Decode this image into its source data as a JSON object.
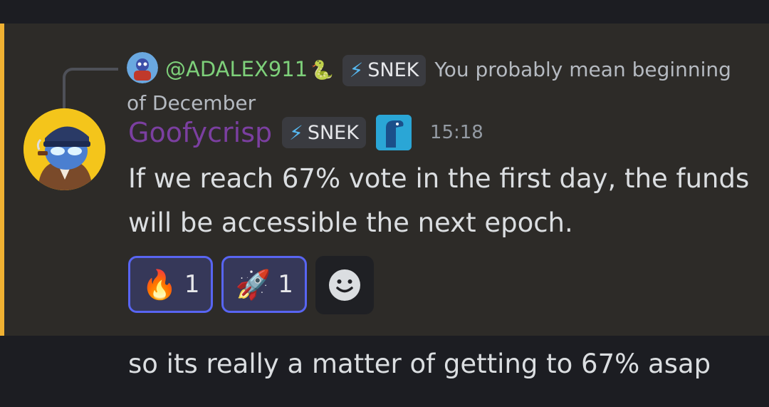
{
  "reply": {
    "username": "@ADALEX911",
    "username_emoji": "🐍",
    "tag_icon": "⚡",
    "tag_label": "SNEK",
    "text": "You probably mean beginning of December"
  },
  "message": {
    "username": "Goofycrisp",
    "tag_icon": "⚡",
    "tag_label": "SNEK",
    "timestamp": "15:18",
    "text": "If we reach 67% vote in the first day, the funds will be accessible the next epoch."
  },
  "reactions": [
    {
      "emoji": "🔥",
      "count": "1"
    },
    {
      "emoji": "🚀",
      "count": "1"
    }
  ],
  "next_message": {
    "text": "so its really a matter of getting to 67% asap"
  },
  "colors": {
    "highlight_bar": "#f0b132",
    "reply_name": "#7ed07a",
    "username": "#7b3fa0",
    "reaction_border": "#5865f2"
  }
}
